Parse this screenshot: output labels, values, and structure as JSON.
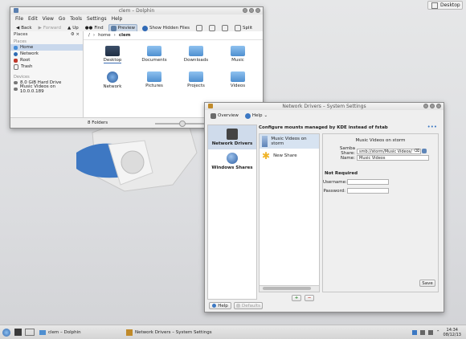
{
  "desktop": {
    "button_label": "Desktop"
  },
  "dolphin": {
    "title": "clem – Dolphin",
    "menu": [
      "File",
      "Edit",
      "View",
      "Go",
      "Tools",
      "Settings",
      "Help"
    ],
    "toolbar": {
      "back": "Back",
      "forward": "Forward",
      "up": "Up",
      "find": "Find",
      "preview": "Preview",
      "hidden": "Show Hidden Files",
      "split": "Split"
    },
    "places": {
      "header": "Places",
      "section_places": "Places",
      "items": [
        "Home",
        "Network",
        "Root",
        "Trash"
      ],
      "section_devices": "Devices",
      "devices": [
        "8.0 GiB Hard Drive",
        "Music Videos on 10.0.0.189"
      ]
    },
    "breadcrumb": {
      "root": "/",
      "home": "home",
      "current": "clem"
    },
    "files": [
      "Desktop",
      "Documents",
      "Downloads",
      "Music",
      "Network",
      "Pictures",
      "Projects",
      "Videos"
    ],
    "status": "8 Folders"
  },
  "settings": {
    "title": "Network Drivers – System Settings",
    "toolbar": {
      "overview": "Overview",
      "help": "Help"
    },
    "nav": [
      "Network Drivers",
      "Windows Shares"
    ],
    "heading": "Configure mounts managed by KDE instead of fstab",
    "mounts": [
      "Music Videos on storm",
      "New Share"
    ],
    "form": {
      "title": "Music Videos on storm",
      "share_label": "Samba Share:",
      "share_value": "smb://storm/Music Videos/",
      "name_label": "Name:",
      "name_value": "Music Videos",
      "not_required": "Not Required",
      "username_label": "Username:",
      "password_label": "Password:",
      "save": "Save"
    },
    "bottom": {
      "help": "Help",
      "defaults": "Defaults"
    }
  },
  "taskbar": {
    "tasks": [
      "clem – Dolphin",
      "Network Drivers – System Settings"
    ],
    "time": "14:34",
    "date": "08/12/13"
  }
}
